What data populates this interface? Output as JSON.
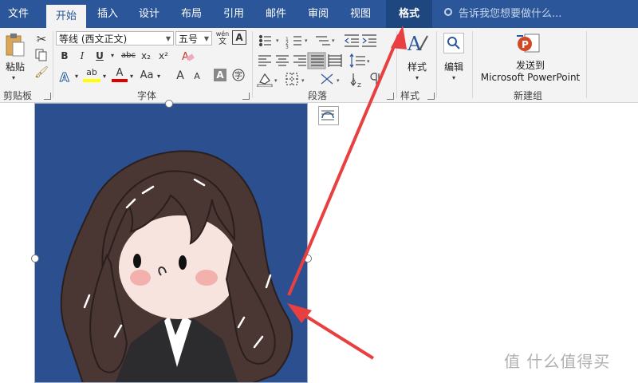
{
  "tabs": [
    "文件",
    "开始",
    "插入",
    "设计",
    "布局",
    "引用",
    "邮件",
    "审阅",
    "视图",
    "格式"
  ],
  "tell_me": "告诉我您想要做什么...",
  "clipboard": {
    "paste": "粘贴",
    "group": "剪贴板"
  },
  "font": {
    "name": "等线 (西文正文)",
    "size": "五号",
    "group": "字体",
    "phonetic": "wén",
    "phonetic_sub": "文",
    "buttons": {
      "bold": "B",
      "italic": "I",
      "underline": "U",
      "strike": "abc",
      "subscript": "x₂",
      "superscript": "x²",
      "grow": "A",
      "shrink": "A",
      "case": "Aa",
      "char_border": "A",
      "char_shade": "A",
      "highlight": "ab",
      "color": "A"
    }
  },
  "paragraph": {
    "group": "段落"
  },
  "styles": {
    "label": "样式",
    "group": "样式"
  },
  "editing": {
    "label": "编辑"
  },
  "new_group": {
    "send_line1": "发送到",
    "send_line2": "Microsoft PowerPoint",
    "group": "新建组"
  },
  "colors": {
    "ribbon_blue": "#2b579a",
    "image_bg": "#2b4f8f",
    "arrow": "#e84040"
  },
  "watermark": "值 什么值得买"
}
